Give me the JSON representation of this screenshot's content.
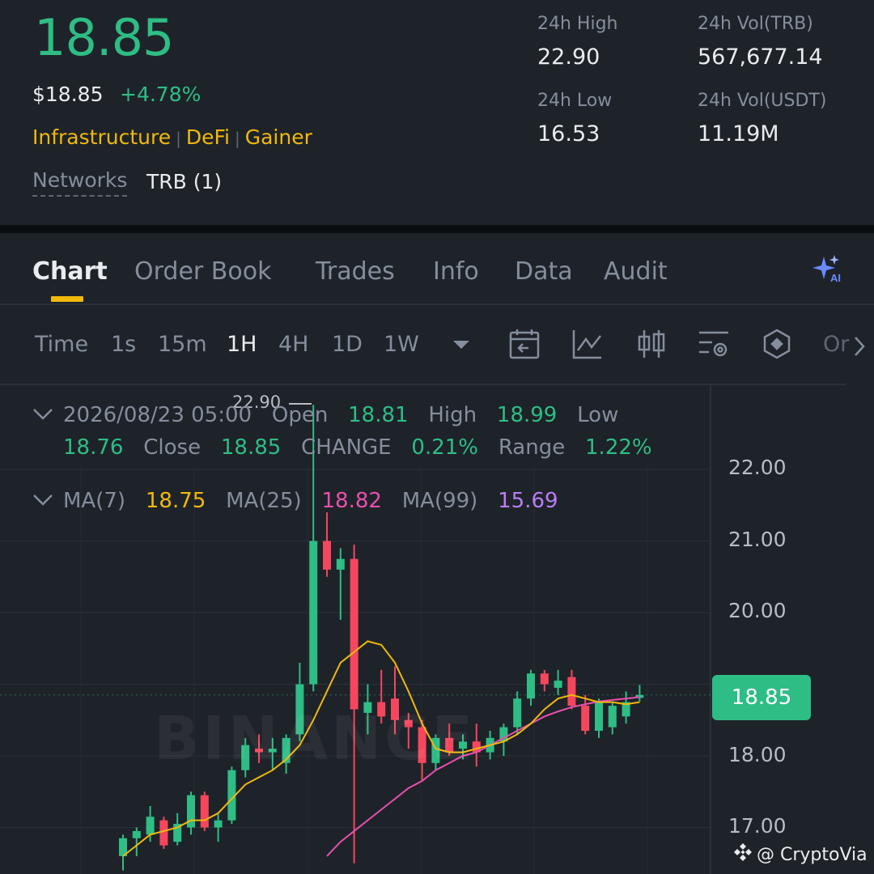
{
  "ticker": {
    "last_price": "18.85",
    "usd_price": "$18.85",
    "change_pct": "+4.78%",
    "tags": [
      "Infrastructure",
      "DeFi",
      "Gainer"
    ],
    "networks_label": "Networks",
    "networks_value": "TRB (1)",
    "stats": {
      "high_label": "24h High",
      "high_value": "22.90",
      "vol_trb_label": "24h Vol(TRB)",
      "vol_trb_value": "567,677.14",
      "low_label": "24h Low",
      "low_value": "16.53",
      "vol_usdt_label": "24h Vol(USDT)",
      "vol_usdt_value": "11.19M"
    }
  },
  "tabs": [
    "Chart",
    "Order Book",
    "Trades",
    "Info",
    "Data",
    "Audit"
  ],
  "active_tab": "Chart",
  "intervals": [
    "Time",
    "1s",
    "15m",
    "1H",
    "4H",
    "1D",
    "1W"
  ],
  "active_interval": "1H",
  "toolbar_icons": [
    "dropdown-caret-icon",
    "calendar-icon",
    "indicator-icon",
    "candle-type-icon",
    "settings-icon",
    "hexagon-icon",
    "more-icon"
  ],
  "toolbar_more_label": "Or",
  "ohlc": {
    "datetime": "2026/08/23 05:00",
    "open_label": "Open",
    "open": "18.81",
    "high_label": "High",
    "high": "18.99",
    "low_label": "Low",
    "low": "18.76",
    "close_label": "Close",
    "close": "18.85",
    "change_label": "CHANGE",
    "change": "0.21%",
    "range_label": "Range",
    "range": "1.22%"
  },
  "ma": {
    "ma7_label": "MA(7)",
    "ma7": "18.75",
    "ma25_label": "MA(25)",
    "ma25": "18.82",
    "ma99_label": "MA(99)",
    "ma99": "15.69"
  },
  "colors": {
    "up": "#2ebd85",
    "down": "#f6465d",
    "ma7": "#f0b90b",
    "ma25": "#e84fae",
    "ma99": "#b87ef5",
    "accent": "#f0b90b"
  },
  "price_axis": [
    "22.00",
    "21.00",
    "20.00",
    "18.00",
    "17.00"
  ],
  "current_price_tag": "18.85",
  "high_marker": "22.90",
  "watermark": "BINANCE",
  "footer_credit": "@ CryptoVia",
  "chart_data": {
    "type": "candlestick",
    "ylim": [
      16.5,
      23.0
    ],
    "candles": [
      {
        "o": 16.6,
        "h": 16.9,
        "l": 16.4,
        "c": 16.85
      },
      {
        "o": 16.85,
        "h": 17.0,
        "l": 16.6,
        "c": 16.95
      },
      {
        "o": 16.9,
        "h": 17.3,
        "l": 16.8,
        "c": 17.15
      },
      {
        "o": 17.1,
        "h": 17.15,
        "l": 16.7,
        "c": 16.75
      },
      {
        "o": 16.8,
        "h": 17.2,
        "l": 16.75,
        "c": 17.05
      },
      {
        "o": 17.0,
        "h": 17.5,
        "l": 16.9,
        "c": 17.45
      },
      {
        "o": 17.45,
        "h": 17.5,
        "l": 16.95,
        "c": 17.0
      },
      {
        "o": 17.0,
        "h": 17.2,
        "l": 16.8,
        "c": 17.1
      },
      {
        "o": 17.1,
        "h": 17.85,
        "l": 17.05,
        "c": 17.8
      },
      {
        "o": 17.8,
        "h": 18.25,
        "l": 17.7,
        "c": 18.15
      },
      {
        "o": 18.1,
        "h": 18.3,
        "l": 17.9,
        "c": 18.05
      },
      {
        "o": 18.05,
        "h": 18.25,
        "l": 17.8,
        "c": 18.1
      },
      {
        "o": 17.9,
        "h": 18.3,
        "l": 17.75,
        "c": 18.25
      },
      {
        "o": 18.3,
        "h": 19.3,
        "l": 18.2,
        "c": 19.0
      },
      {
        "o": 19.0,
        "h": 22.9,
        "l": 18.9,
        "c": 21.0
      },
      {
        "o": 21.0,
        "h": 21.4,
        "l": 20.5,
        "c": 20.6
      },
      {
        "o": 20.6,
        "h": 20.9,
        "l": 19.9,
        "c": 20.75
      },
      {
        "o": 20.75,
        "h": 20.95,
        "l": 16.5,
        "c": 18.65
      },
      {
        "o": 18.6,
        "h": 19.0,
        "l": 18.3,
        "c": 18.75
      },
      {
        "o": 18.75,
        "h": 19.2,
        "l": 18.45,
        "c": 18.55
      },
      {
        "o": 18.8,
        "h": 19.25,
        "l": 18.3,
        "c": 18.5
      },
      {
        "o": 18.5,
        "h": 18.6,
        "l": 18.1,
        "c": 18.4
      },
      {
        "o": 18.4,
        "h": 18.5,
        "l": 17.65,
        "c": 17.9
      },
      {
        "o": 17.9,
        "h": 18.3,
        "l": 17.8,
        "c": 18.25
      },
      {
        "o": 18.25,
        "h": 18.45,
        "l": 18.0,
        "c": 18.05
      },
      {
        "o": 18.1,
        "h": 18.3,
        "l": 17.95,
        "c": 18.2
      },
      {
        "o": 18.2,
        "h": 18.45,
        "l": 17.85,
        "c": 18.05
      },
      {
        "o": 18.05,
        "h": 18.35,
        "l": 17.95,
        "c": 18.25
      },
      {
        "o": 18.2,
        "h": 18.45,
        "l": 18.0,
        "c": 18.4
      },
      {
        "o": 18.4,
        "h": 18.9,
        "l": 18.3,
        "c": 18.8
      },
      {
        "o": 18.8,
        "h": 19.2,
        "l": 18.7,
        "c": 19.15
      },
      {
        "o": 19.15,
        "h": 19.2,
        "l": 18.9,
        "c": 19.0
      },
      {
        "o": 18.95,
        "h": 19.2,
        "l": 18.85,
        "c": 19.05
      },
      {
        "o": 19.1,
        "h": 19.2,
        "l": 18.65,
        "c": 18.7
      },
      {
        "o": 18.7,
        "h": 18.85,
        "l": 18.3,
        "c": 18.35
      },
      {
        "o": 18.35,
        "h": 18.8,
        "l": 18.25,
        "c": 18.75
      },
      {
        "o": 18.4,
        "h": 18.75,
        "l": 18.3,
        "c": 18.7
      },
      {
        "o": 18.55,
        "h": 18.9,
        "l": 18.45,
        "c": 18.75
      },
      {
        "o": 18.81,
        "h": 18.99,
        "l": 18.76,
        "c": 18.85
      }
    ],
    "ma7": [
      16.6,
      16.75,
      16.9,
      16.95,
      17.0,
      17.1,
      17.1,
      17.2,
      17.4,
      17.6,
      17.7,
      17.8,
      17.95,
      18.15,
      18.5,
      18.9,
      19.3,
      19.45,
      19.6,
      19.55,
      19.3,
      18.9,
      18.45,
      18.1,
      18.05,
      18.05,
      18.1,
      18.15,
      18.2,
      18.3,
      18.45,
      18.65,
      18.8,
      18.85,
      18.8,
      18.75,
      18.75,
      18.72,
      18.75
    ],
    "ma25": [
      null,
      null,
      null,
      null,
      null,
      null,
      null,
      null,
      null,
      null,
      null,
      null,
      null,
      null,
      null,
      16.6,
      16.8,
      16.95,
      17.1,
      17.25,
      17.4,
      17.55,
      17.65,
      17.8,
      17.9,
      18.0,
      18.05,
      18.15,
      18.25,
      18.35,
      18.45,
      18.55,
      18.62,
      18.68,
      18.72,
      18.76,
      18.78,
      18.8,
      18.82
    ],
    "ma99_value": 15.69
  }
}
